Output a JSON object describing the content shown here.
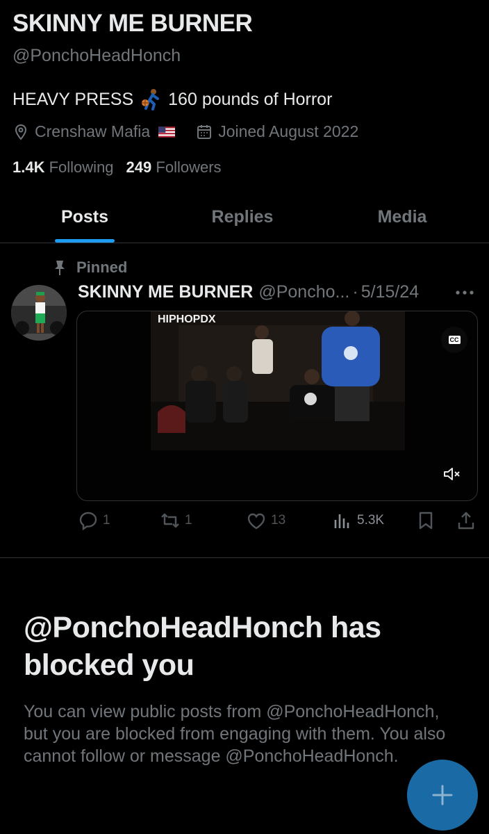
{
  "profile": {
    "name": "SKINNY ME BURNER",
    "handle": "@PonchoHeadHonch",
    "bio_before_emoji": "HEAVY PRESS",
    "bio_after_emoji": "160 pounds of Horror",
    "location": "Crenshaw Mafia",
    "joined": "Joined August 2022",
    "following_count": "1.4K",
    "following_label": "Following",
    "followers_count": "249",
    "followers_label": "Followers"
  },
  "tabs": [
    {
      "label": "Posts",
      "active": true
    },
    {
      "label": "Replies",
      "active": false
    },
    {
      "label": "Media",
      "active": false
    }
  ],
  "post": {
    "pinned_label": "Pinned",
    "author": "SKINNY ME BURNER",
    "handle": "@Poncho...",
    "separator": "·",
    "date": "5/15/24",
    "video_watermark": "HIPHOPDX",
    "cc_label": "CC",
    "replies": "1",
    "reposts": "1",
    "likes": "13",
    "views": "5.3K"
  },
  "blocked": {
    "title": "@PonchoHeadHonch has blocked you",
    "message": "You can view public posts from @PonchoHeadHonch, but you are blocked from engaging with them. You also cannot follow or message @PonchoHeadHonch."
  },
  "colors": {
    "accent": "#1d9bf0",
    "fab": "#1a6aa5",
    "secondary_text": "#71767b",
    "primary_text": "#e7e9ea",
    "background": "#000000"
  },
  "icons": [
    "location-icon",
    "calendar-icon",
    "pin-icon",
    "more-icon",
    "cc-icon",
    "mute-icon",
    "reply-icon",
    "repost-icon",
    "like-icon",
    "views-icon",
    "bookmark-icon",
    "share-icon",
    "plus-icon"
  ]
}
